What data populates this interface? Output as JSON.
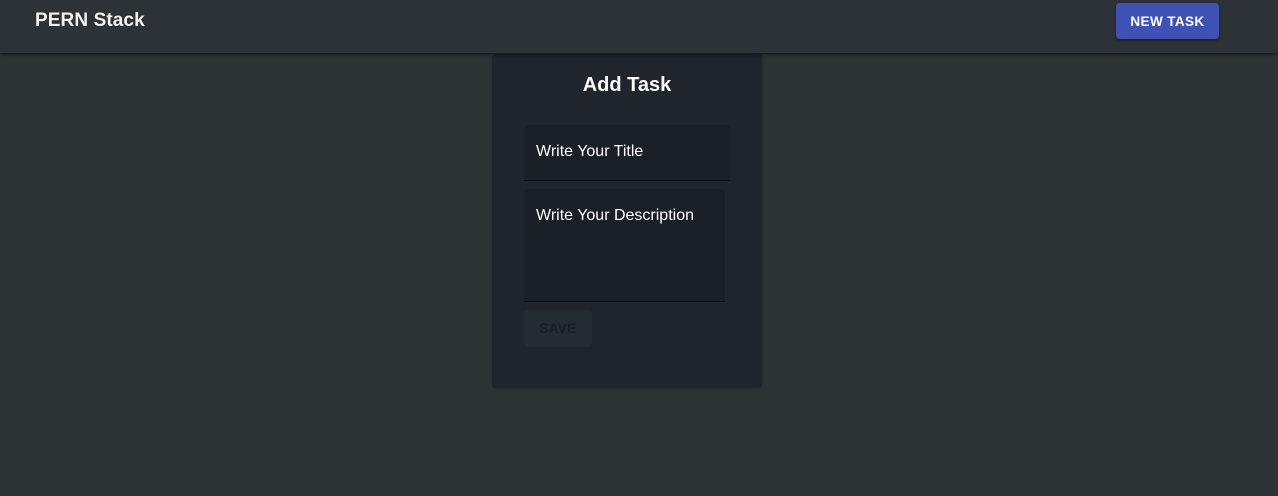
{
  "appbar": {
    "brand": "PERN Stack",
    "new_task_label": "NEW TASK"
  },
  "form": {
    "title": "Add Task",
    "title_field": {
      "placeholder": "Write Your Title"
    },
    "description_field": {
      "placeholder": "Write Your Description"
    },
    "save_label": "SAVE"
  },
  "colors": {
    "background": "#2e3436",
    "appbar": "#2c3235",
    "card": "#1f252b",
    "field": "#1b2027",
    "primary_button": "#3f51b5"
  }
}
